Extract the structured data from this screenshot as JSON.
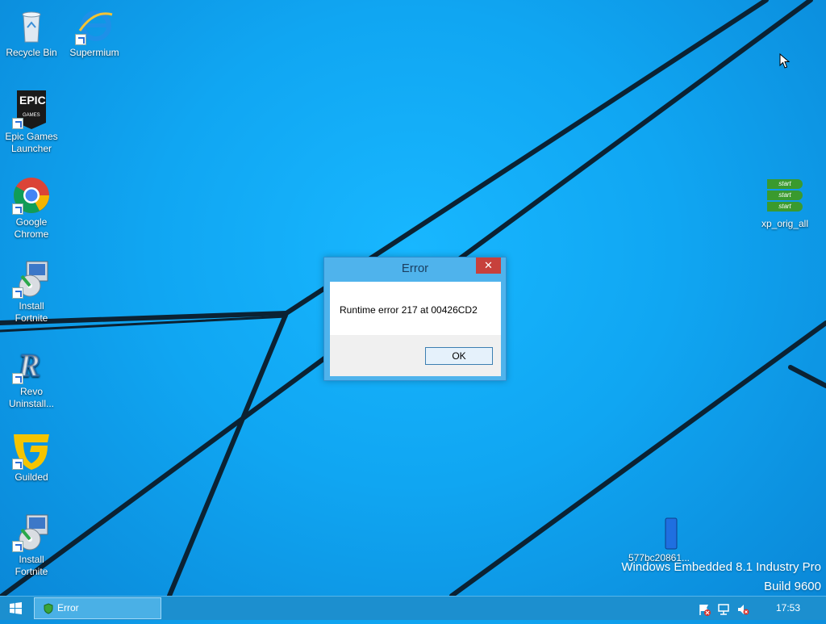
{
  "desktop": {
    "icons": [
      {
        "label": "Recycle Bin"
      },
      {
        "label": "Supermium"
      },
      {
        "label": "Epic Games Launcher",
        "line1": "Epic Games",
        "line2": "Launcher"
      },
      {
        "label": "Google Chrome",
        "line1": "Google",
        "line2": "Chrome"
      },
      {
        "label": "Install Fortnite",
        "line1": "Install",
        "line2": "Fortnite"
      },
      {
        "label": "Revo Uninstall...",
        "line1": "Revo",
        "line2": "Uninstall..."
      },
      {
        "label": "Guilded"
      },
      {
        "label": "Install Fortnite",
        "line1": "Install",
        "line2": "Fortnite"
      },
      {
        "label": "xp_orig_all"
      },
      {
        "label": "577bc20861..."
      }
    ],
    "epic_logo_text": "EPIC",
    "epic_logo_sub": "GAMES",
    "xp_start_label": "start",
    "watermark_line1": "Windows Embedded 8.1 Industry Pro",
    "watermark_line2": "Build 9600"
  },
  "dialog": {
    "title": "Error",
    "close_glyph": "✕",
    "message": "Runtime error 217 at 00426CD2",
    "ok_label": "OK"
  },
  "taskbar": {
    "task_label": "Error",
    "clock": "17:53"
  },
  "colors": {
    "wallpaper": "#10a6f2",
    "taskbar": "#1c8fcf",
    "close_button": "#c7413c"
  }
}
